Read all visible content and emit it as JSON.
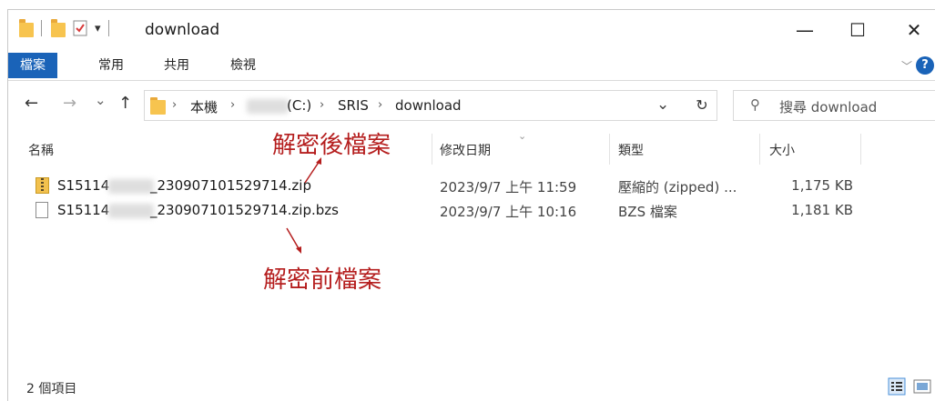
{
  "window": {
    "title": "download",
    "minimize_glyph": "—",
    "maximize_glyph": "☐",
    "close_glyph": "✕",
    "qa_dropdown_glyph": "▾"
  },
  "ribbon": {
    "tabs": [
      "檔案",
      "常用",
      "共用",
      "檢視"
    ],
    "collapse_glyph": "﹀",
    "help_glyph": "?",
    "file_tab_color": "#1a63b8"
  },
  "nav": {
    "back_glyph": "←",
    "forward_glyph": "→",
    "recent_glyph": "⌄",
    "up_glyph": "↑",
    "breadcrumbs": [
      "本機",
      "(C:)",
      "SRIS",
      "download"
    ],
    "crumb_sep": "›",
    "dropdown_glyph": "⌄",
    "refresh_glyph": "↻",
    "search_icon_glyph": "⚲",
    "search_placeholder": "搜尋 download"
  },
  "columns": {
    "name": "名稱",
    "modified": "修改日期",
    "type": "類型",
    "size": "大小",
    "sort_glyph": "⌄"
  },
  "files": [
    {
      "name_prefix": "S15114",
      "name_suffix": "_230907101529714.zip",
      "modified": "2023/9/7 上午 11:59",
      "type": "壓縮的 (zipped) ...",
      "size": "1,175 KB",
      "icon": "zip-folder-icon"
    },
    {
      "name_prefix": "S15114",
      "name_suffix": "_230907101529714.zip.bzs",
      "modified": "2023/9/7 上午 10:16",
      "type": "BZS 檔案",
      "size": "1,181 KB",
      "icon": "file-icon"
    }
  ],
  "annotations": {
    "after": "解密後檔案",
    "before": "解密前檔案",
    "color": "#b51e1e"
  },
  "status": {
    "item_count": "2 個項目"
  }
}
